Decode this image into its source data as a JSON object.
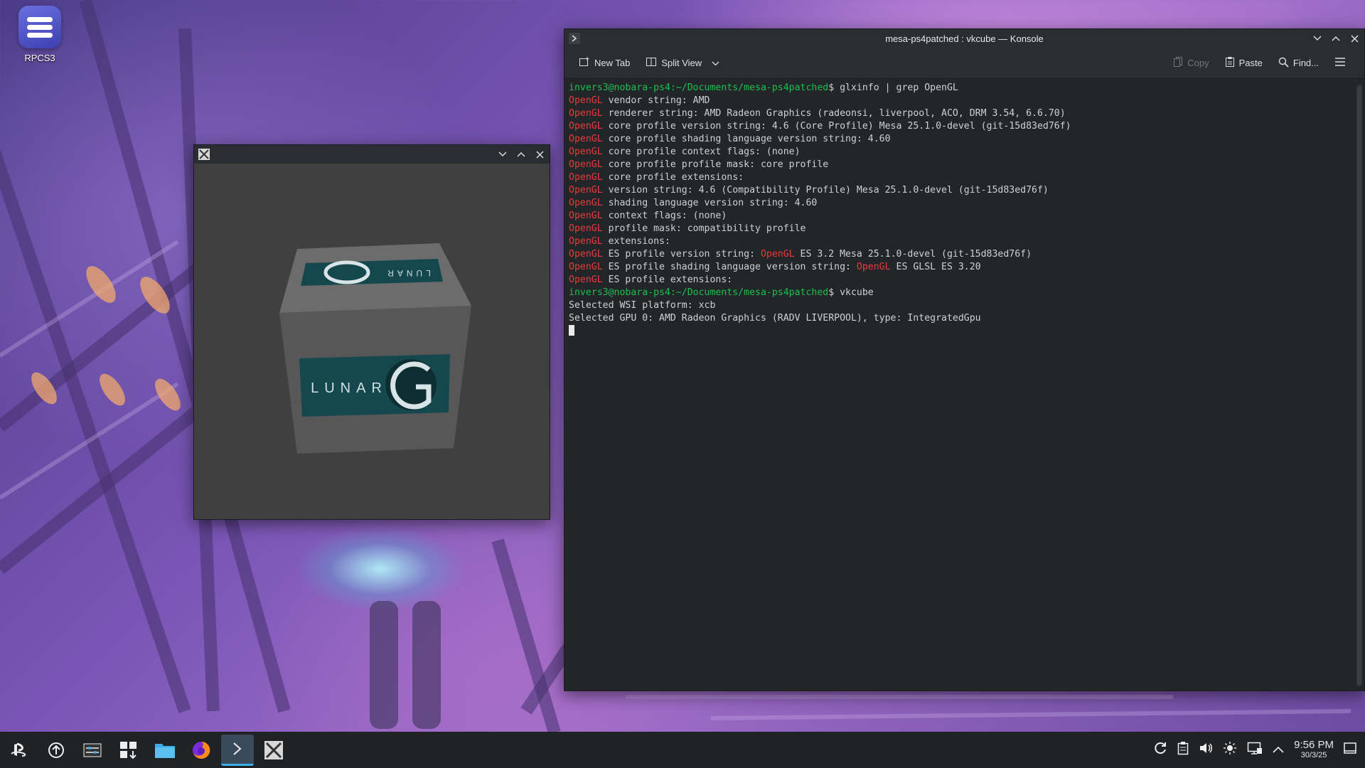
{
  "desktop": {
    "icons": [
      {
        "label": "RPCS3",
        "icon": "rpcs3-app-icon"
      }
    ]
  },
  "vkcube_window": {
    "title_icon": "x11-app-icon",
    "cube_label": "LUNAR G",
    "controls": {
      "minimize": "minimize-icon",
      "maximize": "maximize-icon",
      "close": "close-icon"
    }
  },
  "konsole": {
    "title": "mesa-ps4patched : vkcube — Konsole",
    "toolbar": {
      "new_tab": "New Tab",
      "split_view": "Split View",
      "copy": "Copy",
      "paste": "Paste",
      "find": "Find..."
    },
    "terminal": {
      "lines": [
        {
          "prompt": "invers3@nobara-ps4:~/Documents/mesa-ps4patched",
          "cmd": "$ glxinfo | grep OpenGL"
        },
        {
          "kw": "OpenGL",
          "text": " vendor string: AMD"
        },
        {
          "kw": "OpenGL",
          "text": " renderer string: AMD Radeon Graphics (radeonsi, liverpool, ACO, DRM 3.54, 6.6.70)"
        },
        {
          "kw": "OpenGL",
          "text": " core profile version string: 4.6 (Core Profile) Mesa 25.1.0-devel (git-15d83ed76f)"
        },
        {
          "kw": "OpenGL",
          "text": " core profile shading language version string: 4.60"
        },
        {
          "kw": "OpenGL",
          "text": " core profile context flags: (none)"
        },
        {
          "kw": "OpenGL",
          "text": " core profile profile mask: core profile"
        },
        {
          "kw": "OpenGL",
          "text": " core profile extensions:"
        },
        {
          "kw": "OpenGL",
          "text": " version string: 4.6 (Compatibility Profile) Mesa 25.1.0-devel (git-15d83ed76f)"
        },
        {
          "kw": "OpenGL",
          "text": " shading language version string: 4.60"
        },
        {
          "kw": "OpenGL",
          "text": " context flags: (none)"
        },
        {
          "kw": "OpenGL",
          "text": " profile mask: compatibility profile"
        },
        {
          "kw": "OpenGL",
          "text": " extensions:"
        },
        {
          "kw": "OpenGL",
          "text": " ES profile version string: ",
          "kw2": "OpenGL",
          "text2": " ES 3.2 Mesa 25.1.0-devel (git-15d83ed76f)"
        },
        {
          "kw": "OpenGL",
          "text": " ES profile shading language version string: ",
          "kw2": "OpenGL",
          "text2": " ES GLSL ES 3.20"
        },
        {
          "kw": "OpenGL",
          "text": " ES profile extensions:"
        },
        {
          "prompt": "invers3@nobara-ps4:~/Documents/mesa-ps4patched",
          "cmd": "$ vkcube"
        },
        {
          "text": "Selected WSI platform: xcb"
        },
        {
          "text": "Selected GPU 0: AMD Radeon Graphics (RADV LIVERPOOL), type: IntegratedGpu"
        }
      ]
    }
  },
  "taskbar": {
    "items": [
      {
        "name": "application-launcher-icon",
        "active": false
      },
      {
        "name": "update-icon",
        "active": false
      },
      {
        "name": "system-settings-icon",
        "active": false
      },
      {
        "name": "discover-store-icon",
        "active": false
      },
      {
        "name": "file-manager-icon",
        "active": false
      },
      {
        "name": "firefox-icon",
        "active": false
      },
      {
        "name": "konsole-icon",
        "active": true
      },
      {
        "name": "x11-app-icon",
        "active": false
      }
    ],
    "tray": {
      "time": "9:56 PM",
      "date": "30/3/25"
    }
  }
}
